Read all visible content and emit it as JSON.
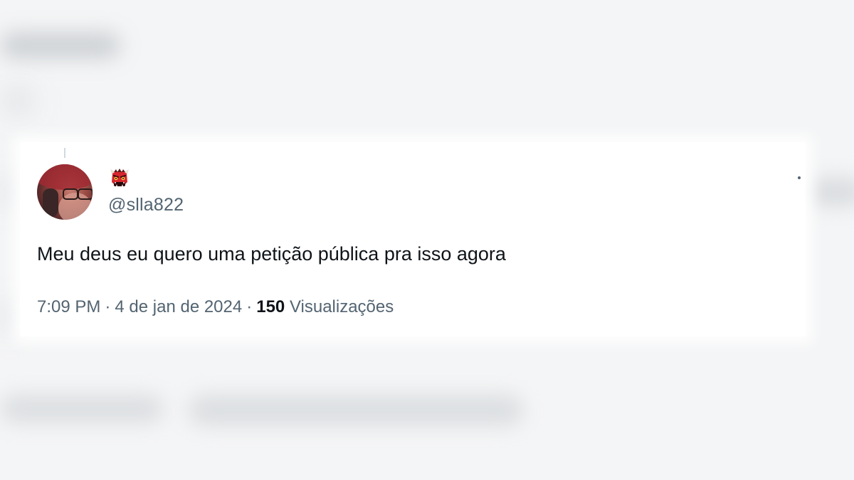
{
  "tweet": {
    "display_name_icon": "ogre-emoji-icon",
    "handle": "@slla822",
    "text": "Meu deus eu quero uma petição pública pra isso agora",
    "time": "7:09 PM",
    "separator": "·",
    "date": "4 de jan de 2024",
    "views_count": "150",
    "views_label": "Visualizações"
  },
  "colors": {
    "text_primary": "#0f1419",
    "text_secondary": "#536471",
    "card_background": "#ffffff",
    "page_background": "#f4f5f6"
  }
}
